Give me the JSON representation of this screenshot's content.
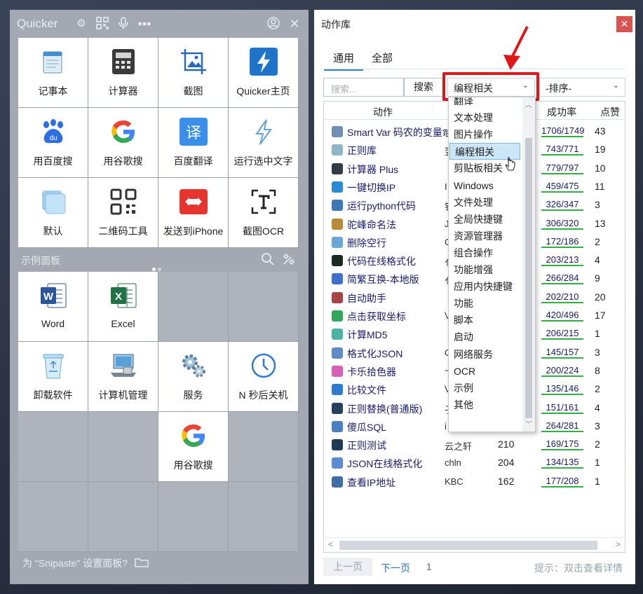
{
  "quicker": {
    "title": "Quicker",
    "top_panel": [
      {
        "label": "记事本",
        "icon": "notepad-icon"
      },
      {
        "label": "计算器",
        "icon": "calculator-icon"
      },
      {
        "label": "截图",
        "icon": "screenshot-icon"
      },
      {
        "label": "Quicker主页",
        "icon": "quicker-bolt-icon"
      },
      {
        "label": "用百度搜",
        "icon": "baidu-icon"
      },
      {
        "label": "用谷歌搜",
        "icon": "google-icon"
      },
      {
        "label": "百度翻译",
        "icon": "baidu-translate-icon"
      },
      {
        "label": "运行选中文字",
        "icon": "run-bolt-icon"
      },
      {
        "label": "默认",
        "icon": "default-icon"
      },
      {
        "label": "二维码工具",
        "icon": "qrcode-icon"
      },
      {
        "label": "发送到iPhone",
        "icon": "send-iphone-icon"
      },
      {
        "label": "截图OCR",
        "icon": "ocr-icon"
      }
    ],
    "section_label": "示例面板",
    "sample_panel": [
      {
        "label": "Word",
        "icon": "word-icon"
      },
      {
        "label": "Excel",
        "icon": "excel-icon"
      },
      {
        "label": "",
        "icon": ""
      },
      {
        "label": "",
        "icon": ""
      },
      {
        "label": "卸载软件",
        "icon": "recycle-bin-icon"
      },
      {
        "label": "计算机管理",
        "icon": "computer-management-icon"
      },
      {
        "label": "服务",
        "icon": "services-gear-icon"
      },
      {
        "label": "N 秒后关机",
        "icon": "clock-icon"
      },
      {
        "label": "",
        "icon": ""
      },
      {
        "label": "",
        "icon": ""
      },
      {
        "label": "用谷歌搜",
        "icon": "google-icon"
      },
      {
        "label": "",
        "icon": ""
      }
    ],
    "footer": "为 \"Snipaste\" 设置面板?"
  },
  "library": {
    "title": "动作库",
    "tabs": [
      "通用",
      "全部"
    ],
    "search_placeholder": "搜索...",
    "search_button": "搜索",
    "category_selected": "编程相关",
    "sort_selected": "-排序-",
    "columns": {
      "action": "动作",
      "success": "成功率",
      "likes": "点赞"
    },
    "rows": [
      {
        "name": "Smart Var 码农的变量命名",
        "author": "铲",
        "count": "",
        "rate": "1706/1749",
        "likes": "43",
        "color": "#6f8fb5"
      },
      {
        "name": "正则库",
        "author": "翌",
        "count": "",
        "rate": "743/771",
        "likes": "19",
        "color": "#8fb3c9"
      },
      {
        "name": "计算器 Plus",
        "author": "",
        "count": "",
        "rate": "779/797",
        "likes": "10",
        "color": "#333c46"
      },
      {
        "name": "一键切换IP",
        "author": "I",
        "count": "",
        "rate": "459/475",
        "likes": "11",
        "color": "#2a8bd6"
      },
      {
        "name": "运行python代码",
        "author": "钅",
        "count": "",
        "rate": "326/347",
        "likes": "3",
        "color": "#3c78b5"
      },
      {
        "name": "驼峰命名法",
        "author": "J",
        "count": "",
        "rate": "306/320",
        "likes": "13",
        "color": "#b98a3a"
      },
      {
        "name": "删除空行",
        "author": "C",
        "count": "",
        "rate": "172/186",
        "likes": "2",
        "color": "#6aa6d8"
      },
      {
        "name": "代码在线格式化",
        "author": "亻",
        "count": "",
        "rate": "203/213",
        "likes": "4",
        "color": "#1c2b22"
      },
      {
        "name": "简繁互换-本地版",
        "author": "亻",
        "count": "",
        "rate": "266/284",
        "likes": "9",
        "color": "#3d6fcc"
      },
      {
        "name": "自动助手",
        "author": "",
        "count": "",
        "rate": "202/210",
        "likes": "20",
        "color": "#a44"
      },
      {
        "name": "点击获取坐标",
        "author": "V",
        "count": "",
        "rate": "420/496",
        "likes": "17",
        "color": "#33a85a"
      },
      {
        "name": "计算MD5",
        "author": "",
        "count": "",
        "rate": "206/215",
        "likes": "1",
        "color": "#4ab3a2"
      },
      {
        "name": "格式化JSON",
        "author": "C",
        "count": "",
        "rate": "145/157",
        "likes": "3",
        "color": "#5f8cc7"
      },
      {
        "name": "卡乐拾色器",
        "author": "卞",
        "count": "",
        "rate": "200/224",
        "likes": "8",
        "color": "#d75fb5"
      },
      {
        "name": "比较文件",
        "author": "V",
        "count": "",
        "rate": "135/146",
        "likes": "2",
        "color": "#2d7cd1"
      },
      {
        "name": "正则替换(普通版)",
        "author": "子",
        "count": "",
        "rate": "151/161",
        "likes": "4",
        "color": "#26415e"
      },
      {
        "name": "傻瓜SQL",
        "author": "i",
        "count": "",
        "rate": "264/281",
        "likes": "3",
        "color": "#4c7fbf"
      },
      {
        "name": "正则测试",
        "author": "云之轩",
        "count": "210",
        "rate": "169/175",
        "likes": "2",
        "color": "#1e3a55"
      },
      {
        "name": "JSON在线格式化",
        "author": "chln",
        "count": "204",
        "rate": "134/135",
        "likes": "1",
        "color": "#5d8bd4"
      },
      {
        "name": "查看IP地址",
        "author": "KBC",
        "count": "162",
        "rate": "177/208",
        "likes": "1",
        "color": "#3d6fa5"
      }
    ],
    "dropdown_options": [
      "翻译",
      "文本处理",
      "图片操作",
      "编程相关",
      "剪贴板相关",
      "Windows",
      "文件处理",
      "全局快捷键",
      "资源管理器",
      "组合操作",
      "功能增强",
      "应用内快捷键",
      "功能",
      "脚本",
      "启动",
      "网络服务",
      "OCR",
      "示例",
      "其他"
    ],
    "pager": {
      "prev": "上一页",
      "next": "下一页",
      "page": "1",
      "hint": "提示：双击查看详情"
    }
  },
  "colors": {
    "accent": "#2b84d8",
    "highlight_box": "#e0161b",
    "rate_bar": "#2fae44"
  }
}
